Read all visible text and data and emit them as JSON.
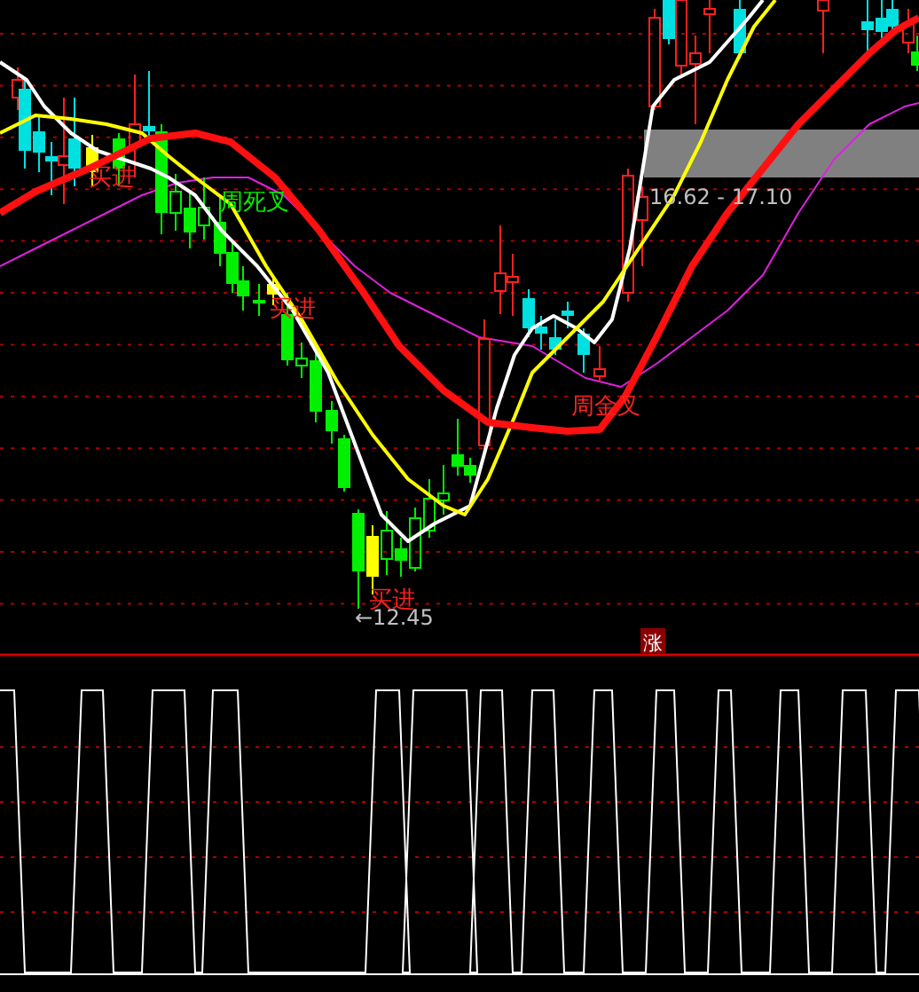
{
  "chart": {
    "signals": [
      {
        "text": "买进",
        "kind": "buy"
      },
      {
        "text": "周死叉",
        "kind": "death_cross"
      },
      {
        "text": "买进",
        "kind": "buy"
      },
      {
        "text": "周金叉",
        "kind": "golden_cross"
      },
      {
        "text": "买进",
        "kind": "buy"
      }
    ],
    "price_band": {
      "label": "16.62 - 17.10"
    },
    "low_marker": "←12.45",
    "badge": "涨"
  }
}
